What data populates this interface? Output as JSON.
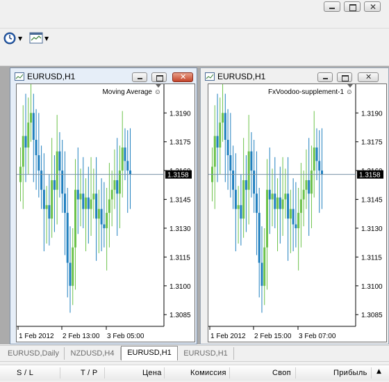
{
  "charts": [
    {
      "title": "EURUSD,H1",
      "indicator": "Moving Average",
      "price_tag": "1.3158",
      "y_labels": [
        "1.3190",
        "1.3175",
        "1.3160",
        "1.3145",
        "1.3130",
        "1.3115",
        "1.3100",
        "1.3085"
      ],
      "x_labels": [
        "1 Feb 2012",
        "2 Feb 13:00",
        "3 Feb 05:00"
      ]
    },
    {
      "title": "EURUSD,H1",
      "indicator": "FxVoodoo-supplement-1",
      "price_tag": "1.3158",
      "y_labels": [
        "1.3190",
        "1.3175",
        "1.3160",
        "1.3145",
        "1.3130",
        "1.3115",
        "1.3100",
        "1.3085"
      ],
      "x_labels": [
        "1 Feb 2012",
        "2 Feb 15:00",
        "3 Feb 07:00"
      ]
    }
  ],
  "chart_data": [
    {
      "type": "bar",
      "title": "",
      "candles_close": [
        1.3162,
        1.3178,
        1.3172,
        1.3185,
        1.319,
        1.3176,
        1.3168,
        1.316,
        1.315,
        1.314,
        1.3142,
        1.3135,
        1.3155,
        1.315,
        1.317,
        1.316,
        1.3148,
        1.3138,
        1.3112,
        1.31,
        1.312,
        1.315,
        1.3145,
        1.3148,
        1.314,
        1.3146,
        1.314,
        1.3145,
        1.3148,
        1.3135,
        1.314,
        1.3132,
        1.313,
        1.3138,
        1.3145,
        1.315,
        1.3155,
        1.3148,
        1.316,
        1.3172,
        1.3165,
        1.316,
        1.3158
      ],
      "current_price": 1.3158,
      "ylim": [
        1.308,
        1.3197
      ]
    },
    {
      "type": "bar",
      "title": "",
      "candles_close": [
        1.3162,
        1.3178,
        1.3172,
        1.3185,
        1.319,
        1.3176,
        1.3168,
        1.316,
        1.315,
        1.314,
        1.3142,
        1.3135,
        1.3155,
        1.315,
        1.317,
        1.316,
        1.3148,
        1.3138,
        1.3112,
        1.31,
        1.312,
        1.315,
        1.3145,
        1.3148,
        1.314,
        1.3146,
        1.314,
        1.3145,
        1.3148,
        1.3135,
        1.314,
        1.3132,
        1.313,
        1.3138,
        1.3145,
        1.315,
        1.3155,
        1.3148,
        1.316,
        1.3172,
        1.3165,
        1.316,
        1.3158
      ],
      "current_price": 1.3158,
      "ylim": [
        1.308,
        1.3197
      ]
    }
  ],
  "colors": {
    "bull": "#6cc24a",
    "bear": "#1f7fbf",
    "price_line": "#7a93a6",
    "tag_bg": "#000000"
  },
  "tabs": [
    {
      "label": "EURUSD,Daily",
      "selected": false
    },
    {
      "label": "NZDUSD,H4",
      "selected": false
    },
    {
      "label": "EURUSD,H1",
      "selected": true
    },
    {
      "label": "EURUSD,H1",
      "selected": false
    }
  ],
  "terminal_columns": [
    "S / L",
    "T / P",
    "Цена",
    "Комиссия",
    "Своп",
    "Прибыль"
  ],
  "icons": {
    "toolbar": [
      "clock-icon",
      "chart-window-icon"
    ],
    "window": [
      "minimize-icon",
      "maximize-icon",
      "close-icon"
    ]
  }
}
